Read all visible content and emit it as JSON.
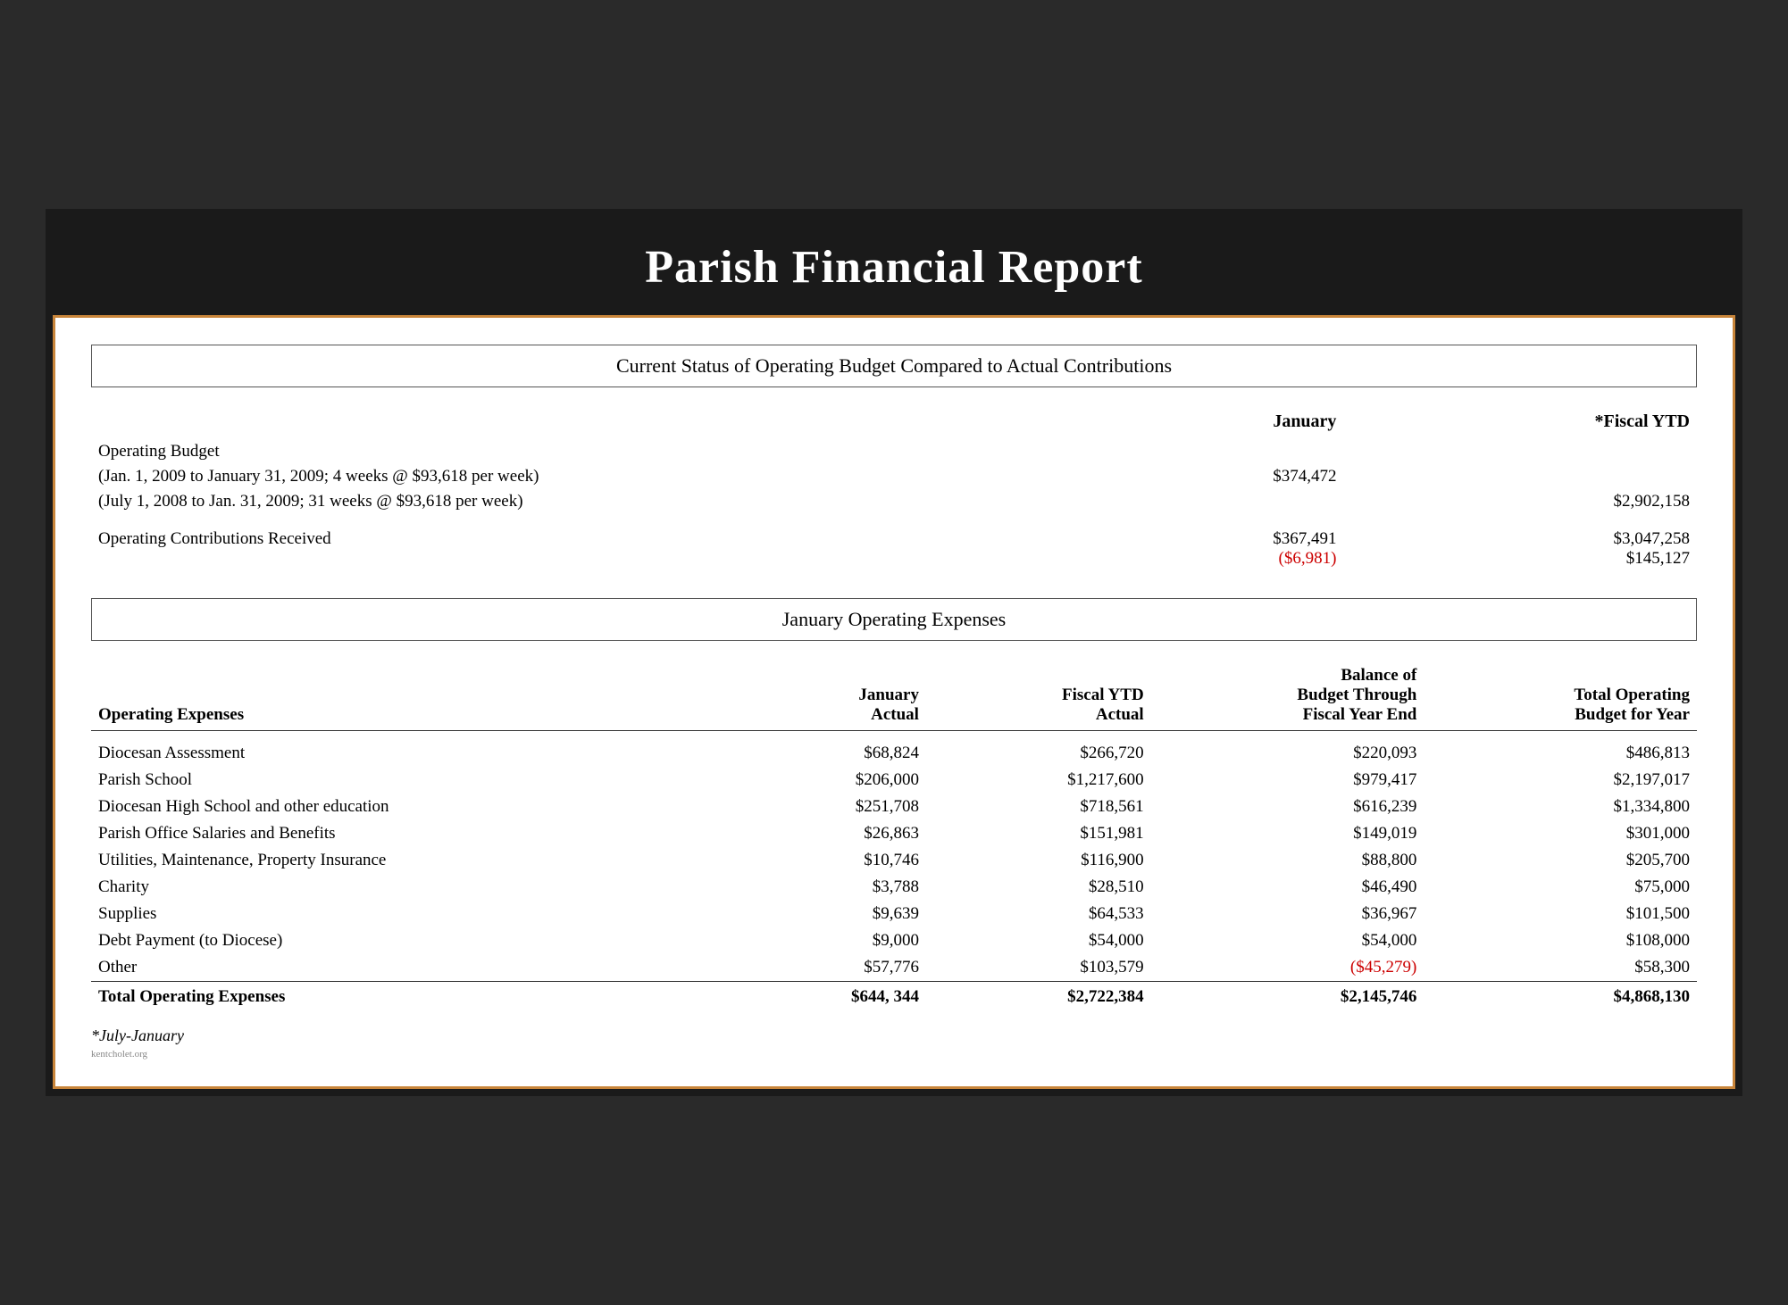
{
  "page": {
    "title": "Parish Financial Report",
    "outer_bg": "#1a1a1a",
    "border_color": "#c8853a"
  },
  "section1": {
    "box_title": "Current Status of Operating Budget Compared to Actual Contributions",
    "col_jan": "January",
    "col_ytd": "*Fiscal YTD",
    "operating_budget_label": "Operating Budget",
    "ob_line1": "(Jan. 1, 2009 to January 31, 2009; 4 weeks @ $93,618 per week)",
    "ob_line1_jan": "$374,472",
    "ob_line1_ytd": "",
    "ob_line2": "(July 1, 2008 to Jan. 31, 2009; 31 weeks @ $93,618 per week)",
    "ob_line2_jan": "",
    "ob_line2_ytd": "$2,902,158",
    "contributions_label": "Operating Contributions Received",
    "contrib_jan": "$367,491",
    "contrib_jan_diff": "($6,981)",
    "contrib_ytd": "$3,047,258",
    "contrib_ytd_diff": "$145,127"
  },
  "section2": {
    "box_title": "January Operating Expenses",
    "col_label": "Operating Expenses",
    "col_jan": "January\nActual",
    "col_ytd": "Fiscal YTD\nActual",
    "col_balance": "Balance of\nBudget Through\nFiscal Year End",
    "col_total": "Total Operating\nBudget for Year",
    "rows": [
      {
        "label": "Diocesan Assessment",
        "jan": "$68,824",
        "ytd": "$266,720",
        "balance": "$220,093",
        "total": "$486,813"
      },
      {
        "label": "Parish School",
        "jan": "$206,000",
        "ytd": "$1,217,600",
        "balance": "$979,417",
        "total": "$2,197,017"
      },
      {
        "label": "Diocesan High School and other education",
        "jan": "$251,708",
        "ytd": "$718,561",
        "balance": "$616,239",
        "total": "$1,334,800"
      },
      {
        "label": "Parish Office Salaries and Benefits",
        "jan": "$26,863",
        "ytd": "$151,981",
        "balance": "$149,019",
        "total": "$301,000"
      },
      {
        "label": "Utilities, Maintenance, Property Insurance",
        "jan": "$10,746",
        "ytd": "$116,900",
        "balance": "$88,800",
        "total": "$205,700"
      },
      {
        "label": "Charity",
        "jan": "$3,788",
        "ytd": "$28,510",
        "balance": "$46,490",
        "total": "$75,000"
      },
      {
        "label": "Supplies",
        "jan": "$9,639",
        "ytd": "$64,533",
        "balance": "$36,967",
        "total": "$101,500"
      },
      {
        "label": "Debt Payment (to Diocese)",
        "jan": "$9,000",
        "ytd": "$54,000",
        "balance": "$54,000",
        "total": "$108,000"
      },
      {
        "label": "Other",
        "jan": "$57,776",
        "ytd": "$103,579",
        "balance": "($45,279)",
        "total": "$58,300",
        "balance_red": true
      }
    ],
    "total_row": {
      "label": "Total Operating Expenses",
      "jan": "$644, 344",
      "ytd": "$2,722,384",
      "balance": "$2,145,746",
      "total": "$4,868,130"
    },
    "footnote": "*July-January"
  }
}
